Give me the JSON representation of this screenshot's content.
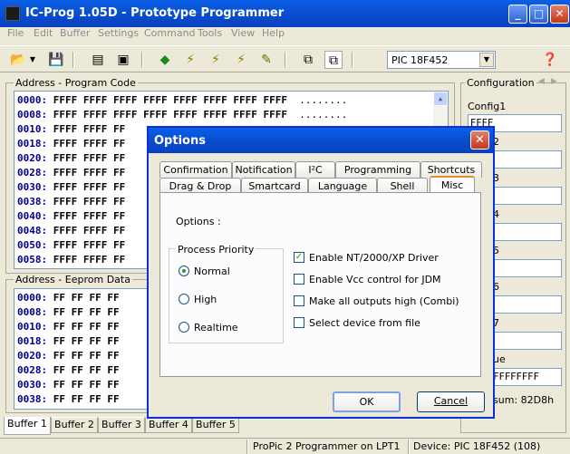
{
  "window": {
    "title": "IC-Prog 1.05D - Prototype Programmer",
    "min": "_",
    "max": "□",
    "close": "✕"
  },
  "menu": [
    "File",
    "Edit",
    "Buffer",
    "Settings",
    "Command",
    "Tools",
    "View",
    "Help"
  ],
  "toolbar": {
    "device": "PIC 18F452"
  },
  "program": {
    "label": "Address - Program Code",
    "rows": [
      {
        "addr": "0000:",
        "data": "FFFF FFFF FFFF FFFF FFFF FFFF FFFF FFFF",
        "ascii": "........"
      },
      {
        "addr": "0008:",
        "data": "FFFF FFFF FFFF FFFF FFFF FFFF FFFF FFFF",
        "ascii": "........"
      },
      {
        "addr": "0010:",
        "data": "FFFF FFFF FF"
      },
      {
        "addr": "0018:",
        "data": "FFFF FFFF FF"
      },
      {
        "addr": "0020:",
        "data": "FFFF FFFF FF"
      },
      {
        "addr": "0028:",
        "data": "FFFF FFFF FF"
      },
      {
        "addr": "0030:",
        "data": "FFFF FFFF FF"
      },
      {
        "addr": "0038:",
        "data": "FFFF FFFF FF"
      },
      {
        "addr": "0040:",
        "data": "FFFF FFFF FF"
      },
      {
        "addr": "0048:",
        "data": "FFFF FFFF FF"
      },
      {
        "addr": "0050:",
        "data": "FFFF FFFF FF"
      },
      {
        "addr": "0058:",
        "data": "FFFF FFFF FF"
      }
    ]
  },
  "eeprom": {
    "label": "Address - Eeprom Data",
    "rows": [
      {
        "addr": "0000:",
        "data": "FF FF FF FF"
      },
      {
        "addr": "0008:",
        "data": "FF FF FF FF"
      },
      {
        "addr": "0010:",
        "data": "FF FF FF FF"
      },
      {
        "addr": "0018:",
        "data": "FF FF FF FF"
      },
      {
        "addr": "0020:",
        "data": "FF FF FF FF"
      },
      {
        "addr": "0028:",
        "data": "FF FF FF FF"
      },
      {
        "addr": "0030:",
        "data": "FF FF FF FF"
      },
      {
        "addr": "0038:",
        "data": "FF FF FF FF"
      }
    ]
  },
  "config": {
    "label": "Configuration",
    "config1_label": "Config1",
    "config1_value": "FFFF",
    "frag2": "2",
    "frag3": "3",
    "frag4": "4",
    "frag5": "5",
    "frag6": "6",
    "frag7": "7",
    "frag_value": "ue",
    "id_value": "FFFFFFFFFFFF",
    "checksum": "sum: 82D8h"
  },
  "buffers": [
    "Buffer 1",
    "Buffer 2",
    "Buffer 3",
    "Buffer 4",
    "Buffer 5"
  ],
  "status": {
    "programmer": "ProPic 2 Programmer on LPT1",
    "device": "Device: PIC 18F452  (108)"
  },
  "dialog": {
    "title": "Options",
    "tabs_row1": [
      "Confirmation",
      "Notification",
      "I²C",
      "Programming",
      "Shortcuts"
    ],
    "tabs_row2": [
      "Drag & Drop",
      "Smartcard",
      "Language",
      "Shell",
      "Misc"
    ],
    "options_label": "Options :",
    "priority": {
      "label": "Process Priority",
      "options": [
        "Normal",
        "High",
        "Realtime"
      ],
      "selected": "Normal"
    },
    "checks": [
      {
        "label": "Enable NT/2000/XP Driver",
        "checked": true
      },
      {
        "label": "Enable Vcc control for JDM",
        "checked": false
      },
      {
        "label": "Make all outputs high (Combi)",
        "checked": false
      },
      {
        "label": "Select device from file",
        "checked": false
      }
    ],
    "ok": "OK",
    "cancel": "Cancel"
  }
}
